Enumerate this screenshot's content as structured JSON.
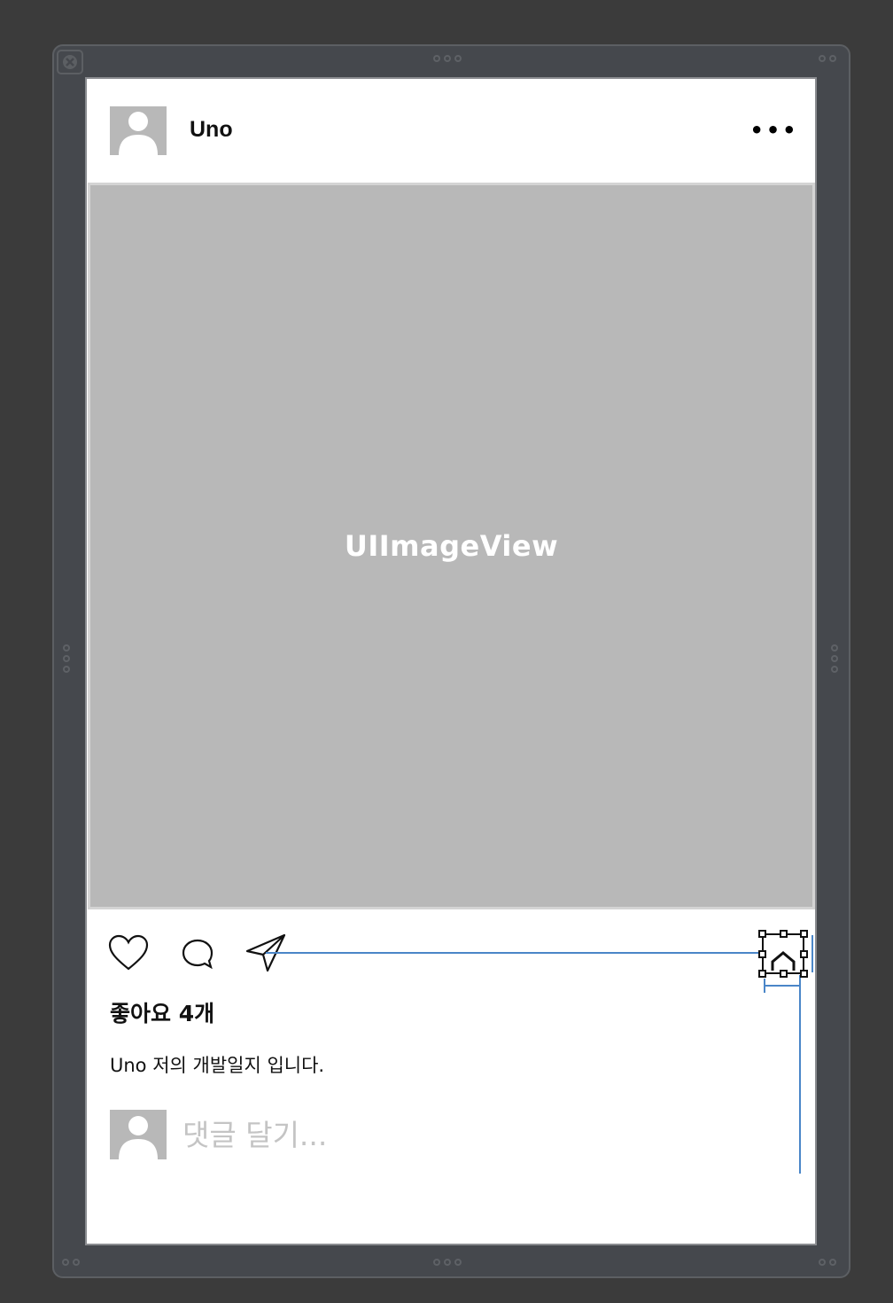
{
  "post": {
    "username": "Uno",
    "more_glyph": "•••",
    "image_placeholder": "UIImageView",
    "likes_text": "좋아요 4개",
    "caption": "Uno 저의 개발일지 입니다.",
    "comment_placeholder": "댓글 달기..."
  },
  "icons": {
    "close": "close-icon",
    "like": "heart-icon",
    "comment": "speech-bubble-icon",
    "share": "paper-plane-icon",
    "bookmark": "bookmark-icon",
    "avatar": "person-icon"
  },
  "colors": {
    "canvas": "#3b3b3b",
    "frame": "#45484d",
    "placeholder_gray": "#b8b8b8",
    "guide_blue": "#4a86c8"
  }
}
